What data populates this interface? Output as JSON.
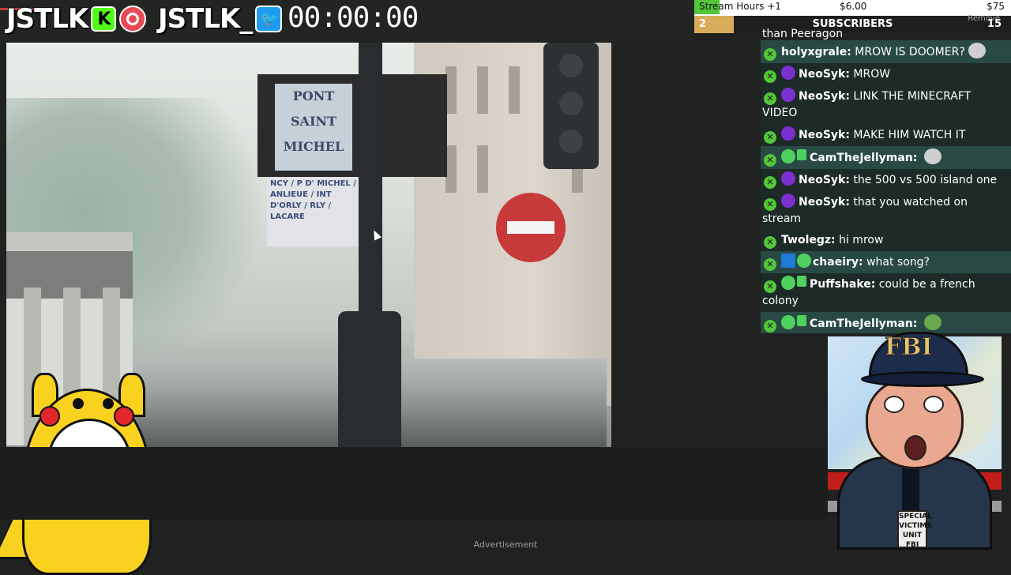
{
  "overlay": {
    "logo_left": "JSTLK",
    "logo_left_badge": "K",
    "logo_right": "JSTLK_",
    "timer": "00:00:00"
  },
  "goal": {
    "label": "Stream Hours +1",
    "amount": "$6.00",
    "target": "$75",
    "progress_fraction": 0.08,
    "sub_count": "2",
    "sub_title": "SUBSCRIBERS",
    "sub_total": "15",
    "remove_label": "Remove"
  },
  "chat": {
    "top_fragment": "than Peeragon",
    "messages": [
      {
        "user": "holyxgrale:",
        "text": "MROW IS DOOMER?",
        "badges": [],
        "emote": "pepe-face",
        "style": "shade"
      },
      {
        "user": "NeoSyk:",
        "text": "MROW",
        "badges": [
          "purple"
        ],
        "emote": "",
        "style": "dark"
      },
      {
        "user": "NeoSyk:",
        "text": "LINK THE MINECRAFT VIDEO",
        "badges": [
          "purple"
        ],
        "emote": "",
        "style": "dark"
      },
      {
        "user": "NeoSyk:",
        "text": "MAKE HIM WATCH IT",
        "badges": [
          "purple"
        ],
        "emote": "",
        "style": "dark"
      },
      {
        "user": "CamTheJellyman:",
        "text": "",
        "badges": [
          "green",
          "gift"
        ],
        "emote": "face",
        "style": "shade"
      },
      {
        "user": "NeoSyk:",
        "text": "the 500 vs 500 island one",
        "badges": [
          "purple"
        ],
        "emote": "",
        "style": "dark"
      },
      {
        "user": "NeoSyk:",
        "text": "that you watched on stream",
        "badges": [
          "purple"
        ],
        "emote": "",
        "style": "dark"
      },
      {
        "user": "Twolegz:",
        "text": "hi mrow",
        "badges": [],
        "emote": "",
        "style": "dark"
      },
      {
        "user": "chaeiry:",
        "text": "what song?",
        "badges": [
          "blue",
          "green"
        ],
        "emote": "",
        "style": "shade"
      },
      {
        "user": "Puffshake:",
        "text": "could be a french colony",
        "badges": [
          "green",
          "gift"
        ],
        "emote": "",
        "style": "dark"
      },
      {
        "user": "CamTheJellyman:",
        "text": "",
        "badges": [
          "green",
          "gift"
        ],
        "emote": "frog",
        "style": "shade"
      }
    ]
  },
  "video": {
    "sign_pont": "PONT SAINT MICHEL",
    "sign_blue": "NCY / P D' MICHEL / ANLIEUE / INT D'ORLY / RLY / LACARE"
  },
  "cam": {
    "cap_text": "FBI",
    "badge_text": "SPECIAL VICTIMS UNIT FBI"
  },
  "footer": {
    "ad_label": "Advertisement"
  }
}
